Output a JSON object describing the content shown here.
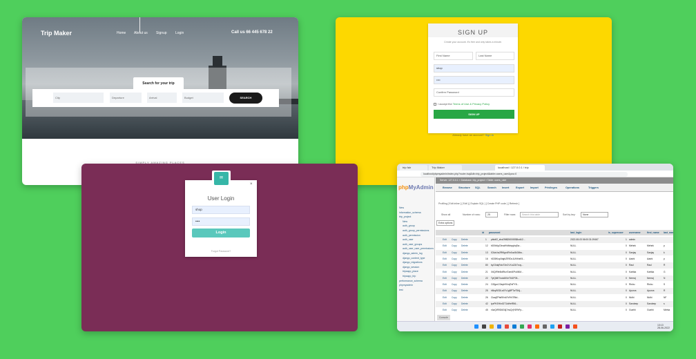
{
  "trip": {
    "brand": "Trip Maker",
    "nav": [
      "Home",
      "About us",
      "Signup",
      "Login"
    ],
    "call": "Call us 66 445 678 22",
    "search_tab": "Search for your trip",
    "fields": [
      "City",
      "Departure",
      "Arrival",
      "Budget"
    ],
    "search_button": "SEARCH",
    "footer": "SIMPLY AMAZING PLACES"
  },
  "signup": {
    "title": "SIGN UP",
    "subtitle": "Create your account. It's free and only takes a minute.",
    "first_name": "First Name",
    "last_name": "Last Name",
    "username": "shop",
    "password": "••••",
    "confirm": "Confirm Password",
    "terms_prefix": "I accept the",
    "terms_link": "Terms of Use & Privacy Policy",
    "button": "SIGN UP",
    "footer_prefix": "Already have an account?",
    "footer_link": "Sign in"
  },
  "login": {
    "logo_text": "✉",
    "close": "×",
    "title": "User Login",
    "username": "shop",
    "password": "••••",
    "button": "Login",
    "forgot": "Forgot Password?"
  },
  "pma": {
    "tabs": [
      "trip fair",
      "Trip Maker",
      "localhost / 127.0.0.1 / trip"
    ],
    "url": "localhost/phpmyadmin/index.php?route=/sql&db=trip_project&table=users_user&pos=0",
    "logo_a": "php",
    "logo_b": "MyAdmin",
    "sidebar": [
      "New",
      "information_schema",
      "trip_project",
      "New",
      "auth_group",
      "auth_group_permissions",
      "auth_permission",
      "auth_user",
      "auth_user_groups",
      "auth_user_user_permissions",
      "django_admin_log",
      "django_content_type",
      "django_migrations",
      "django_session",
      "tripsapp_place",
      "tripsapp_trip",
      "performance_schema",
      "phpmyadmin",
      "test"
    ],
    "crumb": "Server: 127.0.0.1 » Database: trip_project » Table: users_user",
    "menu": [
      "Browse",
      "Structure",
      "SQL",
      "Search",
      "Insert",
      "Export",
      "Import",
      "Privileges",
      "Operations",
      "Triggers"
    ],
    "profiling": "Profiling [ Edit inline ] [ Edit ] [ Explain SQL ] [ Create PHP code ] [ Refresh ]",
    "show_all": "Show all",
    "num_rows_label": "Number of rows:",
    "num_rows": "25",
    "filter_label": "Filter rows:",
    "filter_placeholder": "Search this table",
    "sort_label": "Sort by key:",
    "sort_value": "None",
    "extra_options": "Extra options",
    "columns": [
      "id",
      "password",
      "last_login",
      "is_superuser",
      "username",
      "first_name",
      "last_name"
    ],
    "rows": [
      {
        "id": "1",
        "password": "pbkdf2_sha256$260000$8cdU2...",
        "last_login": "2022-08-03 06:00:31.09467",
        "is_superuser": "1",
        "username": "admin",
        "first_name": "",
        "last_name": ""
      },
      {
        "id": "12",
        "password": "bD0b6pJ3eadHdfobqqbqSw...",
        "last_login": "NULL",
        "is_superuser": "0",
        "username": "Mehek",
        "first_name": "Mehek",
        "last_name": "p"
      },
      {
        "id": "13",
        "password": "lC6wUw2Rf6gn4Rn0uo5k3Mw...",
        "last_login": "NULL",
        "is_superuser": "0",
        "username": "Sanjay",
        "first_name": "Sanjay",
        "last_name": "k"
      },
      {
        "id": "16",
        "password": "hD38Kup0dgbZE9Du1UNHaK5...",
        "last_login": "NULL",
        "is_superuser": "0",
        "username": "Aashi",
        "first_name": "Aashi",
        "last_name": "p"
      },
      {
        "id": "80",
        "password": "kyG0dqRdo73nCVXu1ZkTvuy...",
        "last_login": "NULL",
        "is_superuser": "0",
        "username": "Raul",
        "first_name": "Raul",
        "last_name": "R"
      },
      {
        "id": "21",
        "password": "X6QIRfe5idRbzl7aekEPu6NM...",
        "last_login": "NULL",
        "is_superuser": "0",
        "username": "Kartika",
        "first_name": "Kartika",
        "last_name": "G"
      },
      {
        "id": "22",
        "password": "TyiQ6lE7wdc8iXeT6I1P05...",
        "last_login": "NULL",
        "is_superuser": "0",
        "username": "Neeraj",
        "first_name": "Neeraj",
        "last_name": "N"
      },
      {
        "id": "24",
        "password": "OZlgwJJ3ayb9XmjFaPY8...",
        "last_login": "NULL",
        "is_superuser": "0",
        "username": "Rishu",
        "first_name": "Rishu",
        "last_name": "S"
      },
      {
        "id": "25",
        "password": "hBcyBSDLa07v1gBPTwT5Aj...",
        "last_login": "NULL",
        "is_superuser": "0",
        "username": "Apurva",
        "first_name": "Apurva",
        "last_name": "R"
      },
      {
        "id": "26",
        "password": "ClaajZPtsf5Vs67vRr07Btd...",
        "last_login": "NULL",
        "is_superuser": "0",
        "username": "Nidhi",
        "first_name": "Nidhi",
        "last_name": "NF"
      },
      {
        "id": "42",
        "password": "tyzPKEHInIDT1ldHeRB6...",
        "last_login": "NULL",
        "is_superuser": "0",
        "username": "Sandeep",
        "first_name": "Sandeep",
        "last_name": "s"
      },
      {
        "id": "45",
        "password": "r4wQiR9D6G6j7vwQrjY6FbPp...",
        "last_login": "NULL",
        "is_superuser": "0",
        "username": "Gunthi",
        "first_name": "Gunthi",
        "last_name": "Mehta"
      }
    ],
    "row_actions": [
      "Edit",
      "Copy",
      "Delete"
    ],
    "console": "Console",
    "time": "13:13",
    "date": "28-06-2022"
  },
  "colors": {
    "background": "#4fcf5c",
    "signup_bg": "#fdd800",
    "login_bg": "#7a2d56",
    "signup_button": "#28a745",
    "login_button": "#5ac8bc"
  }
}
